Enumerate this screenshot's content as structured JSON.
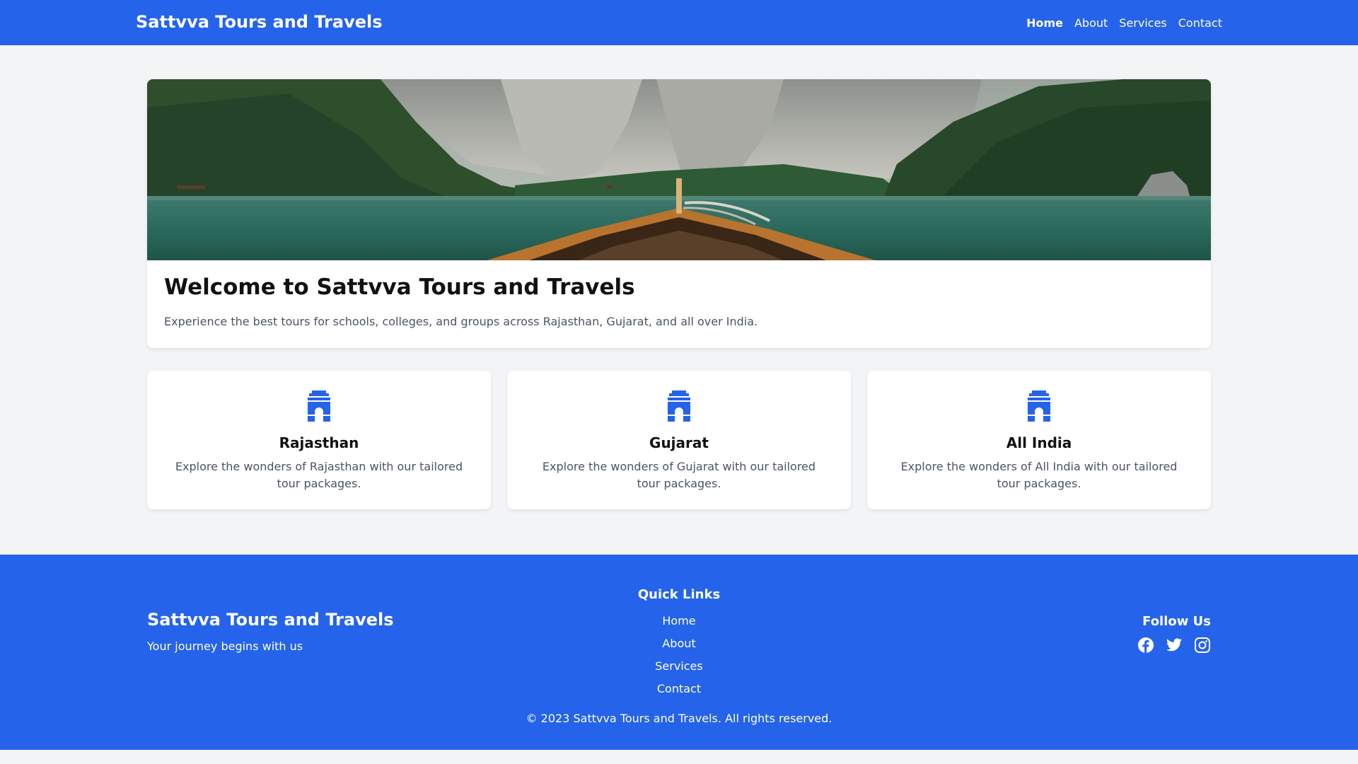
{
  "navbar": {
    "brand": "Sattvva Tours and Travels",
    "links": [
      {
        "label": "Home",
        "active": true
      },
      {
        "label": "About",
        "active": false
      },
      {
        "label": "Services",
        "active": false
      },
      {
        "label": "Contact",
        "active": false
      }
    ]
  },
  "hero": {
    "title": "Welcome to Sattvva Tours and Travels",
    "subtitle": "Experience the best tours for schools, colleges, and groups across Rajasthan, Gujarat, and all over India."
  },
  "cards": [
    {
      "icon": "india-gate-icon",
      "title": "Rajasthan",
      "description": "Explore the wonders of Rajasthan with our tailored tour packages."
    },
    {
      "icon": "india-gate-icon",
      "title": "Gujarat",
      "description": "Explore the wonders of Gujarat with our tailored tour packages."
    },
    {
      "icon": "india-gate-icon",
      "title": "All India",
      "description": "Explore the wonders of All India with our tailored tour packages."
    }
  ],
  "footer": {
    "brand": "Sattvva Tours and Travels",
    "tagline": "Your journey begins with us",
    "quick_links_title": "Quick Links",
    "quick_links": [
      "Home",
      "About",
      "Services",
      "Contact"
    ],
    "follow_title": "Follow Us",
    "social": [
      "facebook-icon",
      "twitter-icon",
      "instagram-icon"
    ],
    "copyright": "© 2023 Sattvva Tours and Travels. All rights reserved."
  },
  "colors": {
    "primary": "#2563eb",
    "background": "#f3f4f6",
    "muted_text": "#4b5563"
  }
}
